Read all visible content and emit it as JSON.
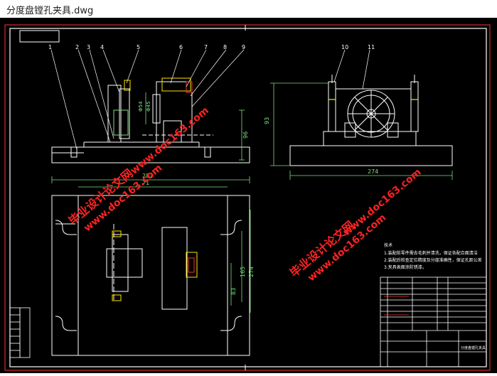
{
  "window": {
    "title": "分度盘镗孔夹具.dwg"
  },
  "drawing": {
    "balloons": [
      "1",
      "2",
      "3",
      "4",
      "5",
      "6",
      "7",
      "8",
      "9",
      "10",
      "11"
    ],
    "dimensions": {
      "top_side_height": "96",
      "front_height": "93",
      "front_width": "274",
      "plan_width": "287",
      "plan_offset": "71",
      "plan_height_a": "165",
      "plan_height_b": "274",
      "plan_height_c": "83",
      "bore_a": "Φ54",
      "bore_b": "Φ45"
    },
    "tech_notes": {
      "heading": "技术",
      "line1": "1.装配前零件需去毛刺并清洗，保证各配合面清洁",
      "line2": "2.装配后检查定位精度及分度准确性，保证孔距公差",
      "line3": "3.夹具表面涂防锈漆。"
    },
    "watermarks": {
      "text_cn": "毕业设计论文网",
      "text_url": "www.doc163.com"
    },
    "title_block": {
      "part_name": "分度盘镗孔夹具"
    }
  },
  "colors": {
    "background": "#000000",
    "line": "#ffffff",
    "accent": "#ff3333",
    "dimension": "#7fe07f",
    "yellow": "#ffe600",
    "watermark": "#ff2222"
  }
}
